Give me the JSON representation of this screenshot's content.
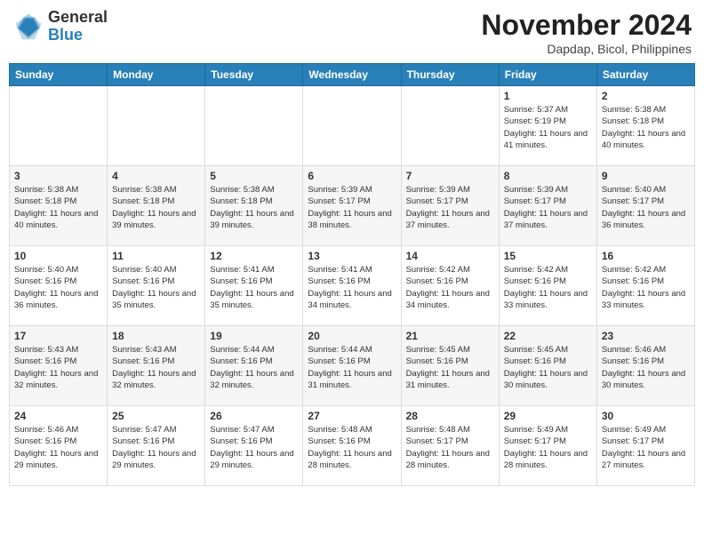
{
  "header": {
    "logo": {
      "line1": "General",
      "line2": "Blue"
    },
    "month": "November 2024",
    "location": "Dapdap, Bicol, Philippines"
  },
  "weekdays": [
    "Sunday",
    "Monday",
    "Tuesday",
    "Wednesday",
    "Thursday",
    "Friday",
    "Saturday"
  ],
  "weeks": [
    [
      {
        "day": "",
        "info": ""
      },
      {
        "day": "",
        "info": ""
      },
      {
        "day": "",
        "info": ""
      },
      {
        "day": "",
        "info": ""
      },
      {
        "day": "",
        "info": ""
      },
      {
        "day": "1",
        "info": "Sunrise: 5:37 AM\nSunset: 5:19 PM\nDaylight: 11 hours and 41 minutes."
      },
      {
        "day": "2",
        "info": "Sunrise: 5:38 AM\nSunset: 5:18 PM\nDaylight: 11 hours and 40 minutes."
      }
    ],
    [
      {
        "day": "3",
        "info": "Sunrise: 5:38 AM\nSunset: 5:18 PM\nDaylight: 11 hours and 40 minutes."
      },
      {
        "day": "4",
        "info": "Sunrise: 5:38 AM\nSunset: 5:18 PM\nDaylight: 11 hours and 39 minutes."
      },
      {
        "day": "5",
        "info": "Sunrise: 5:38 AM\nSunset: 5:18 PM\nDaylight: 11 hours and 39 minutes."
      },
      {
        "day": "6",
        "info": "Sunrise: 5:39 AM\nSunset: 5:17 PM\nDaylight: 11 hours and 38 minutes."
      },
      {
        "day": "7",
        "info": "Sunrise: 5:39 AM\nSunset: 5:17 PM\nDaylight: 11 hours and 37 minutes."
      },
      {
        "day": "8",
        "info": "Sunrise: 5:39 AM\nSunset: 5:17 PM\nDaylight: 11 hours and 37 minutes."
      },
      {
        "day": "9",
        "info": "Sunrise: 5:40 AM\nSunset: 5:17 PM\nDaylight: 11 hours and 36 minutes."
      }
    ],
    [
      {
        "day": "10",
        "info": "Sunrise: 5:40 AM\nSunset: 5:16 PM\nDaylight: 11 hours and 36 minutes."
      },
      {
        "day": "11",
        "info": "Sunrise: 5:40 AM\nSunset: 5:16 PM\nDaylight: 11 hours and 35 minutes."
      },
      {
        "day": "12",
        "info": "Sunrise: 5:41 AM\nSunset: 5:16 PM\nDaylight: 11 hours and 35 minutes."
      },
      {
        "day": "13",
        "info": "Sunrise: 5:41 AM\nSunset: 5:16 PM\nDaylight: 11 hours and 34 minutes."
      },
      {
        "day": "14",
        "info": "Sunrise: 5:42 AM\nSunset: 5:16 PM\nDaylight: 11 hours and 34 minutes."
      },
      {
        "day": "15",
        "info": "Sunrise: 5:42 AM\nSunset: 5:16 PM\nDaylight: 11 hours and 33 minutes."
      },
      {
        "day": "16",
        "info": "Sunrise: 5:42 AM\nSunset: 5:16 PM\nDaylight: 11 hours and 33 minutes."
      }
    ],
    [
      {
        "day": "17",
        "info": "Sunrise: 5:43 AM\nSunset: 5:16 PM\nDaylight: 11 hours and 32 minutes."
      },
      {
        "day": "18",
        "info": "Sunrise: 5:43 AM\nSunset: 5:16 PM\nDaylight: 11 hours and 32 minutes."
      },
      {
        "day": "19",
        "info": "Sunrise: 5:44 AM\nSunset: 5:16 PM\nDaylight: 11 hours and 32 minutes."
      },
      {
        "day": "20",
        "info": "Sunrise: 5:44 AM\nSunset: 5:16 PM\nDaylight: 11 hours and 31 minutes."
      },
      {
        "day": "21",
        "info": "Sunrise: 5:45 AM\nSunset: 5:16 PM\nDaylight: 11 hours and 31 minutes."
      },
      {
        "day": "22",
        "info": "Sunrise: 5:45 AM\nSunset: 5:16 PM\nDaylight: 11 hours and 30 minutes."
      },
      {
        "day": "23",
        "info": "Sunrise: 5:46 AM\nSunset: 5:16 PM\nDaylight: 11 hours and 30 minutes."
      }
    ],
    [
      {
        "day": "24",
        "info": "Sunrise: 5:46 AM\nSunset: 5:16 PM\nDaylight: 11 hours and 29 minutes."
      },
      {
        "day": "25",
        "info": "Sunrise: 5:47 AM\nSunset: 5:16 PM\nDaylight: 11 hours and 29 minutes."
      },
      {
        "day": "26",
        "info": "Sunrise: 5:47 AM\nSunset: 5:16 PM\nDaylight: 11 hours and 29 minutes."
      },
      {
        "day": "27",
        "info": "Sunrise: 5:48 AM\nSunset: 5:16 PM\nDaylight: 11 hours and 28 minutes."
      },
      {
        "day": "28",
        "info": "Sunrise: 5:48 AM\nSunset: 5:17 PM\nDaylight: 11 hours and 28 minutes."
      },
      {
        "day": "29",
        "info": "Sunrise: 5:49 AM\nSunset: 5:17 PM\nDaylight: 11 hours and 28 minutes."
      },
      {
        "day": "30",
        "info": "Sunrise: 5:49 AM\nSunset: 5:17 PM\nDaylight: 11 hours and 27 minutes."
      }
    ]
  ]
}
